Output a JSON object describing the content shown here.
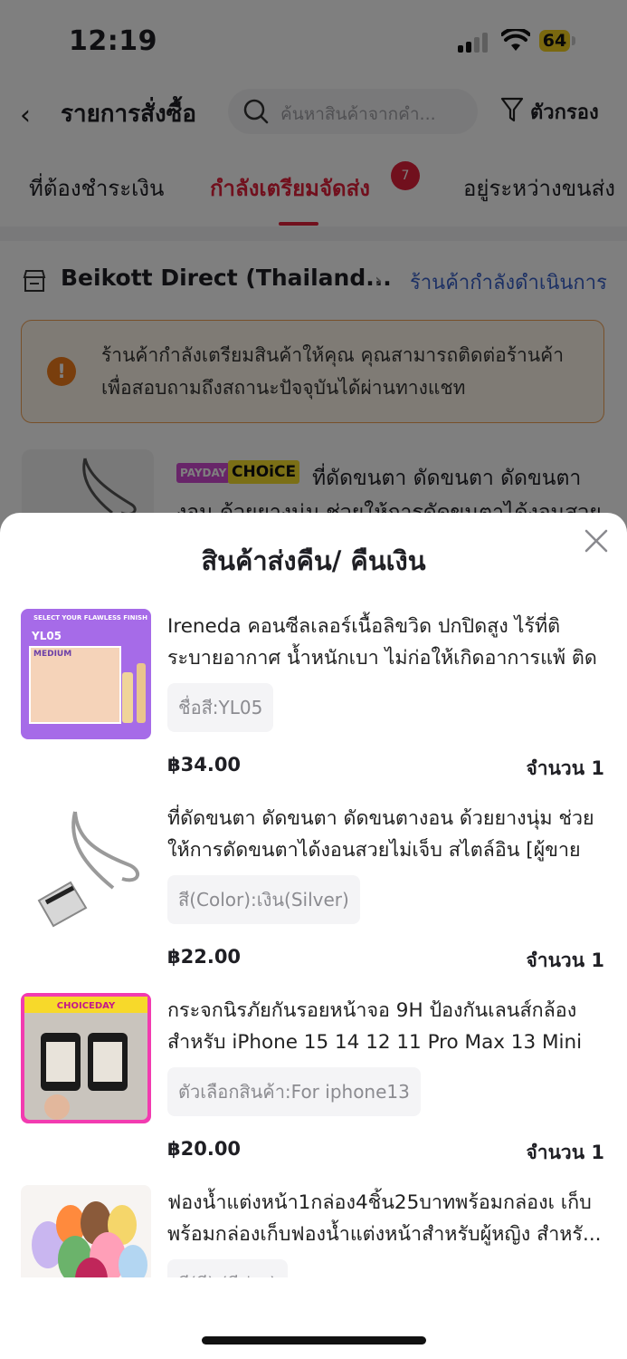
{
  "status_bar": {
    "time": "12:19",
    "battery": "64"
  },
  "header": {
    "title": "รายการสั่งซื้อ",
    "search_placeholder": "ค้นหาสินค้าจากคำ...",
    "filter_label": "ตัวกรอง"
  },
  "tabs": [
    {
      "label": "ที่ต้องชำระเงิน"
    },
    {
      "label": "กำลังเตรียมจัดส่ง",
      "badge": "7",
      "active": true
    },
    {
      "label": "อยู่ระหว่างขนส่ง"
    }
  ],
  "store": {
    "name": "Beikott Direct (Thailand...",
    "status": "ร้านค้ากำลังดำเนินการ",
    "notice": "ร้านค้ากำลังเตรียมสินค้าให้คุณ คุณสามารถติดต่อร้านค้าเพื่อสอบถามถึงสถานะปัจจุบันได้ผ่านทางแชท",
    "bg_item": {
      "tag1": "PAYDAY",
      "tag2": "CHOiCE",
      "title_line1": "ที่ดัดขนตา ดัดขนตา ดัดขนตา",
      "title_line2": "งอน ด้วยยางนุ่ม ช่วยให้การดัดขนตาได้งอนสวย"
    }
  },
  "sheet": {
    "title": "สินค้าส่งคืน/ คืนเงิน",
    "items": [
      {
        "name": "Ireneda คอนซีลเลอร์เนื้อลิขวิด ปกปิดสูง ไร้ที่ติ ระบายอากาศ น้ำหนักเบา ไม่ก่อให้เกิดอาการแพ้ ติดทนนาน...",
        "variant": "ชื่อสี:YL05",
        "price": "฿34.00",
        "qty": "จำนวน 1",
        "thumb_text": {
          "top": "SELECT YOUR FLAWLESS FINISH",
          "code": "YL05",
          "shade": "MEDIUM"
        }
      },
      {
        "name": "ที่ดัดขนตา ดัดขนตา ดัดขนตางอน ด้วยยางนุ่ม ช่วยให้การดัดขนตาได้งอนสวยไม่เจ็บ สไตล์อิน [ผู้ขายชา...",
        "variant": "สี(Color):เงิน(Silver)",
        "price": "฿22.00",
        "qty": "จำนวน 1"
      },
      {
        "name": "กระจกนิรภัยกันรอยหน้าจอ 9H ป้องกันเลนส์กล้อง สำหรับ iPhone 15 14 12 11 Pro Max 13 Mini i...",
        "variant": "ตัวเลือกสินค้า:For iphone13",
        "price": "฿20.00",
        "qty": "จำนวน 1",
        "thumb_text": {
          "banner": "CHOICEDAY"
        }
      },
      {
        "name": "ฟองน้ำแต่งหน้า1กล่อง4ชิ้น25บาทพร้อมกล่องเ เก็บพร้อมกล่องเก็บฟองน้ำแต่งหน้าสำหรับผู้หญิง สำหรั...",
        "variant": "สี(สี):(สีม่วง)"
      }
    ]
  },
  "colors": {
    "accent": "#e2203a",
    "link": "#3960c9",
    "warning": "#f27c1a"
  }
}
